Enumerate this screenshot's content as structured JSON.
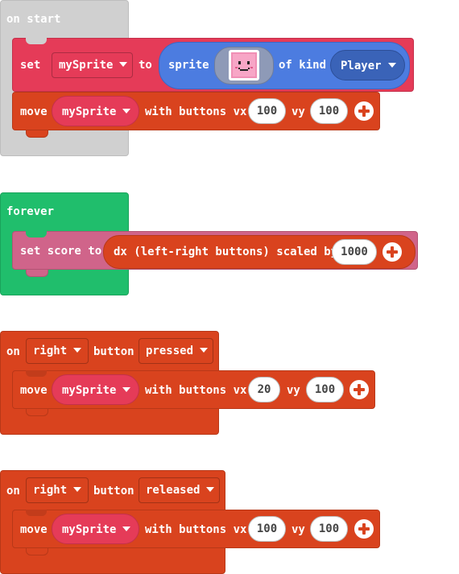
{
  "on_start": {
    "label": "on start",
    "set_block": {
      "set_label": "set",
      "variable": "mySprite",
      "to_label": "to",
      "sprite_label": "sprite",
      "of_kind_label": "of kind",
      "kind": "Player"
    },
    "move_block": {
      "move_label": "move",
      "variable": "mySprite",
      "with_buttons_label": "with buttons vx",
      "vx": "100",
      "vy_label": "vy",
      "vy": "100"
    }
  },
  "forever": {
    "label": "forever",
    "score_block": {
      "set_score_label": "set score to",
      "reporter_label": "dx (left-right buttons) scaled by",
      "scale": "1000"
    }
  },
  "on_right_pressed": {
    "on_label": "on",
    "button_name": "right",
    "button_label": "button",
    "event": "pressed",
    "move_block": {
      "move_label": "move",
      "variable": "mySprite",
      "with_buttons_label": "with buttons vx",
      "vx": "20",
      "vy_label": "vy",
      "vy": "100"
    }
  },
  "on_right_released": {
    "on_label": "on",
    "button_name": "right",
    "button_label": "button",
    "event": "released",
    "move_block": {
      "move_label": "move",
      "variable": "mySprite",
      "with_buttons_label": "with buttons vx",
      "vx": "100",
      "vy_label": "vy",
      "vy": "100"
    }
  },
  "colors": {
    "start_hat": "#d0d0d0",
    "forever_hat": "#20be6c",
    "controller": "#d9431e",
    "sprites": "#e53b58",
    "sprite_reporter": "#4c7ce0",
    "info": "#d0648a"
  }
}
